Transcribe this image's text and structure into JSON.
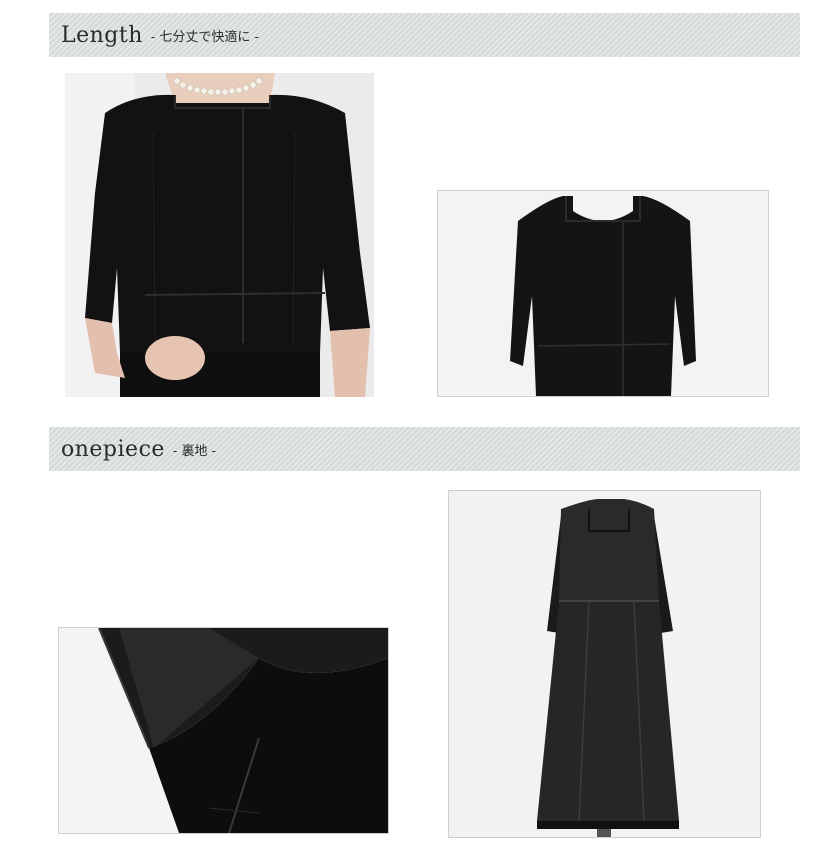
{
  "sections": [
    {
      "title": "Length",
      "subtitle": "- 七分丈で快適に -"
    },
    {
      "title": "onepiece",
      "subtitle": "- 裏地 -"
    }
  ],
  "images": [
    {
      "icon": "model-jacket-closeup-photo"
    },
    {
      "icon": "jacket-on-mannequin-photo"
    },
    {
      "icon": "lining-hem-closeup-photo"
    },
    {
      "icon": "dress-lining-on-mannequin-photo"
    }
  ],
  "colors": {
    "band": "#d6ddd8",
    "garment": "#121212",
    "lining": "#2a2a2a",
    "text": "#2b2b2b"
  }
}
